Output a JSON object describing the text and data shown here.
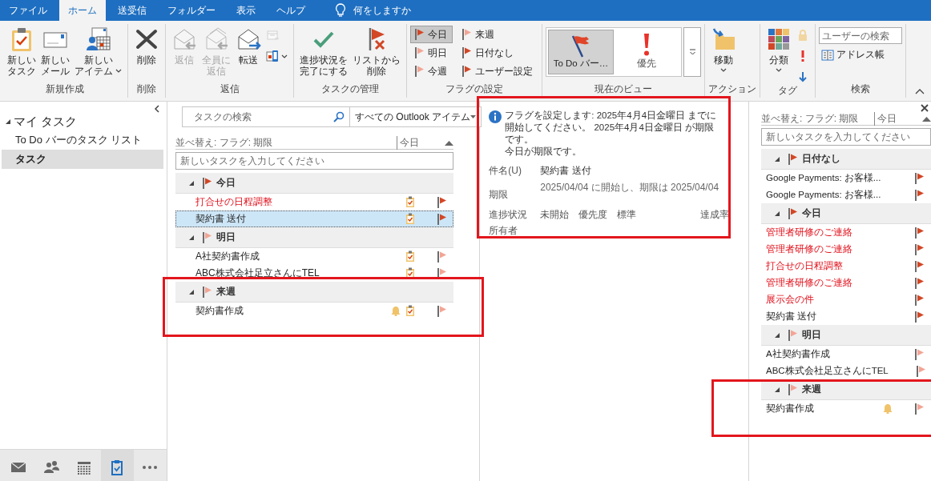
{
  "ribbon_tabs": [
    {
      "label": "ファイル",
      "selected": false
    },
    {
      "label": "ホーム",
      "selected": true
    },
    {
      "label": "送受信",
      "selected": false
    },
    {
      "label": "フォルダー",
      "selected": false
    },
    {
      "label": "表示",
      "selected": false
    },
    {
      "label": "ヘルプ",
      "selected": false
    }
  ],
  "tell_me": "何をしますか",
  "ribbon_groups": [
    {
      "label": "新規作成",
      "items": [
        {
          "kind": "large",
          "lines": [
            "新しい",
            "タスク"
          ],
          "disabled": false,
          "dropdown": false
        },
        {
          "kind": "large",
          "lines": [
            "新しい",
            "メール"
          ],
          "disabled": false,
          "dropdown": false
        },
        {
          "kind": "large",
          "lines": [
            "新しい",
            "アイテム"
          ],
          "disabled": false,
          "dropdown": true
        }
      ]
    },
    {
      "label": "削除",
      "items": [
        {
          "kind": "large",
          "lines": [
            "削除"
          ],
          "disabled": false,
          "dropdown": false
        }
      ]
    },
    {
      "label": "返信",
      "items": [
        {
          "kind": "large",
          "lines": [
            "返信"
          ],
          "disabled": true,
          "dropdown": false
        },
        {
          "kind": "large",
          "lines": [
            "全員に",
            "返信"
          ],
          "disabled": true,
          "dropdown": false
        },
        {
          "kind": "large",
          "lines": [
            "転送"
          ],
          "disabled": false,
          "dropdown": false
        },
        {
          "kind": "icons",
          "buttons": [
            {
              "disabled": true,
              "dropdown": false
            },
            {
              "disabled": false,
              "dropdown": true
            }
          ]
        }
      ]
    },
    {
      "label": "タスクの管理",
      "items": [
        {
          "kind": "large",
          "lines": [
            "進捗状況を",
            "完了にする"
          ],
          "disabled": false,
          "dropdown": false
        },
        {
          "kind": "large",
          "lines": [
            "リストから",
            "削除"
          ],
          "disabled": false,
          "dropdown": false
        }
      ]
    },
    {
      "label": "フラグの設定",
      "items": [
        {
          "kind": "flags",
          "buttons": [
            {
              "label": "今日",
              "color": "#d24726",
              "selected": true
            },
            {
              "label": "明日",
              "color": "#f2a595",
              "selected": false
            },
            {
              "label": "今週",
              "color": "#f2a595",
              "selected": false
            },
            {
              "label": "来週",
              "color": "#f2a595",
              "selected": false
            },
            {
              "label": "日付なし",
              "color": "#d24726",
              "selected": false
            },
            {
              "label": "ユーザー設定",
              "color": "#d24726",
              "selected": false
            }
          ]
        }
      ]
    },
    {
      "label": "現在のビュー",
      "items": [
        {
          "kind": "gallery",
          "options": [
            {
              "label": "To Do バー…",
              "selected": true
            },
            {
              "label": "優先",
              "selected": false
            }
          ]
        }
      ]
    },
    {
      "label": "アクション",
      "items": [
        {
          "kind": "large",
          "lines": [
            "移動"
          ],
          "disabled": false,
          "dropdown": true
        }
      ]
    },
    {
      "label": "タグ",
      "items": [
        {
          "kind": "large",
          "lines": [
            "分類"
          ],
          "disabled": false,
          "dropdown": true
        },
        {
          "kind": "icons",
          "buttons": [
            {
              "disabled": true,
              "dropdown": false
            },
            {
              "disabled": false,
              "dropdown": false
            },
            {
              "disabled": false,
              "dropdown": false
            }
          ]
        }
      ]
    },
    {
      "label": "検索",
      "items": [
        {
          "kind": "search",
          "placeholder": "ユーザーの検索"
        },
        {
          "kind": "small",
          "label": "アドレス帳"
        }
      ]
    }
  ],
  "folders": [
    {
      "label": "マイ タスク",
      "expanded": true,
      "children": [
        {
          "label": "To Do バーのタスク リスト",
          "selected": false
        },
        {
          "label": "タスク",
          "selected": true
        }
      ]
    }
  ],
  "nav_buttons": [
    {
      "selected": false
    },
    {
      "selected": false
    },
    {
      "selected": false
    },
    {
      "selected": true
    },
    {
      "selected": false
    }
  ],
  "task_list": {
    "search": {
      "placeholder": "タスクの検索"
    },
    "scope": "すべての Outlook アイテム",
    "sort_label": "並べ替え: フラグ: 期限",
    "sort_value": "今日",
    "new_task": {
      "placeholder": "新しいタスクを入力してください"
    },
    "groups": [
      {
        "label": "今日",
        "color": "#d24726",
        "expanded": true,
        "tasks": [
          {
            "title": "打合せの日程調整",
            "overdue": true,
            "selected": false,
            "reminder": false,
            "color": "#d24726"
          },
          {
            "title": "契約書  送付",
            "overdue": false,
            "selected": true,
            "reminder": false,
            "color": "#d24726"
          }
        ]
      },
      {
        "label": "明日",
        "color": "#f2a595",
        "expanded": true,
        "tasks": [
          {
            "title": "A社契約書作成",
            "overdue": false,
            "selected": false,
            "reminder": false,
            "color": "#f2a595"
          },
          {
            "title": "ABC株式会社足立さんにTEL",
            "overdue": false,
            "selected": false,
            "reminder": false,
            "color": "#f2a595"
          }
        ]
      },
      {
        "label": "来週",
        "color": "#f2a595",
        "expanded": true,
        "tasks": [
          {
            "title": "契約書作成",
            "overdue": false,
            "selected": false,
            "reminder": true,
            "color": "#f2a595"
          }
        ]
      }
    ]
  },
  "reading_pane": {
    "info": [
      "フラグを設定します:  2025年4月4日金曜日 までに開始してください。 2025年4月4日金曜日 が期限です。",
      "今日が期限です。"
    ],
    "subject_label": "件名(U)",
    "subject": "契約書  送付",
    "due_label": "期限",
    "due": "2025/04/04 に開始し、期限は 2025/04/04",
    "status_label": "進捗状況",
    "status": "未開始",
    "priority_label": "優先度",
    "priority": "標準",
    "percent_label": "達成率",
    "owner_label": "所有者"
  },
  "todo_bar": {
    "sort_label": "並べ替え: フラグ: 期限",
    "sort_value": "今日",
    "new_task": {
      "placeholder": "新しいタスクを入力してください"
    },
    "groups": [
      {
        "label": "日付なし",
        "color": "#d24726",
        "expanded": true,
        "tasks": [
          {
            "title": "Google Payments: お客様...",
            "overdue": false,
            "selected": false,
            "reminder": false,
            "color": "#d24726"
          },
          {
            "title": "Google Payments: お客様...",
            "overdue": false,
            "selected": false,
            "reminder": false,
            "color": "#d24726"
          }
        ]
      },
      {
        "label": "今日",
        "color": "#d24726",
        "expanded": true,
        "tasks": [
          {
            "title": "管理者研修のご連絡",
            "overdue": true,
            "selected": false,
            "reminder": false,
            "color": "#d24726"
          },
          {
            "title": "管理者研修のご連絡",
            "overdue": true,
            "selected": false,
            "reminder": false,
            "color": "#d24726"
          },
          {
            "title": "打合せの日程調整",
            "overdue": true,
            "selected": false,
            "reminder": false,
            "color": "#d24726"
          },
          {
            "title": "管理者研修のご連絡",
            "overdue": true,
            "selected": false,
            "reminder": false,
            "color": "#d24726"
          },
          {
            "title": "展示会の件",
            "overdue": true,
            "selected": false,
            "reminder": false,
            "color": "#d24726"
          },
          {
            "title": "契約書  送付",
            "overdue": false,
            "selected": false,
            "reminder": false,
            "color": "#d24726"
          }
        ]
      },
      {
        "label": "明日",
        "color": "#f2a595",
        "expanded": true,
        "tasks": [
          {
            "title": "A社契約書作成",
            "overdue": false,
            "selected": false,
            "reminder": false,
            "color": "#f2a595"
          },
          {
            "title": "ABC株式会社足立さんにTEL",
            "overdue": false,
            "selected": false,
            "reminder": false,
            "color": "#f2a595"
          }
        ]
      },
      {
        "label": "来週",
        "color": "#f2a595",
        "expanded": true,
        "tasks": [
          {
            "title": "契約書作成",
            "overdue": false,
            "selected": false,
            "reminder": true,
            "color": "#f2a595"
          }
        ]
      }
    ]
  }
}
